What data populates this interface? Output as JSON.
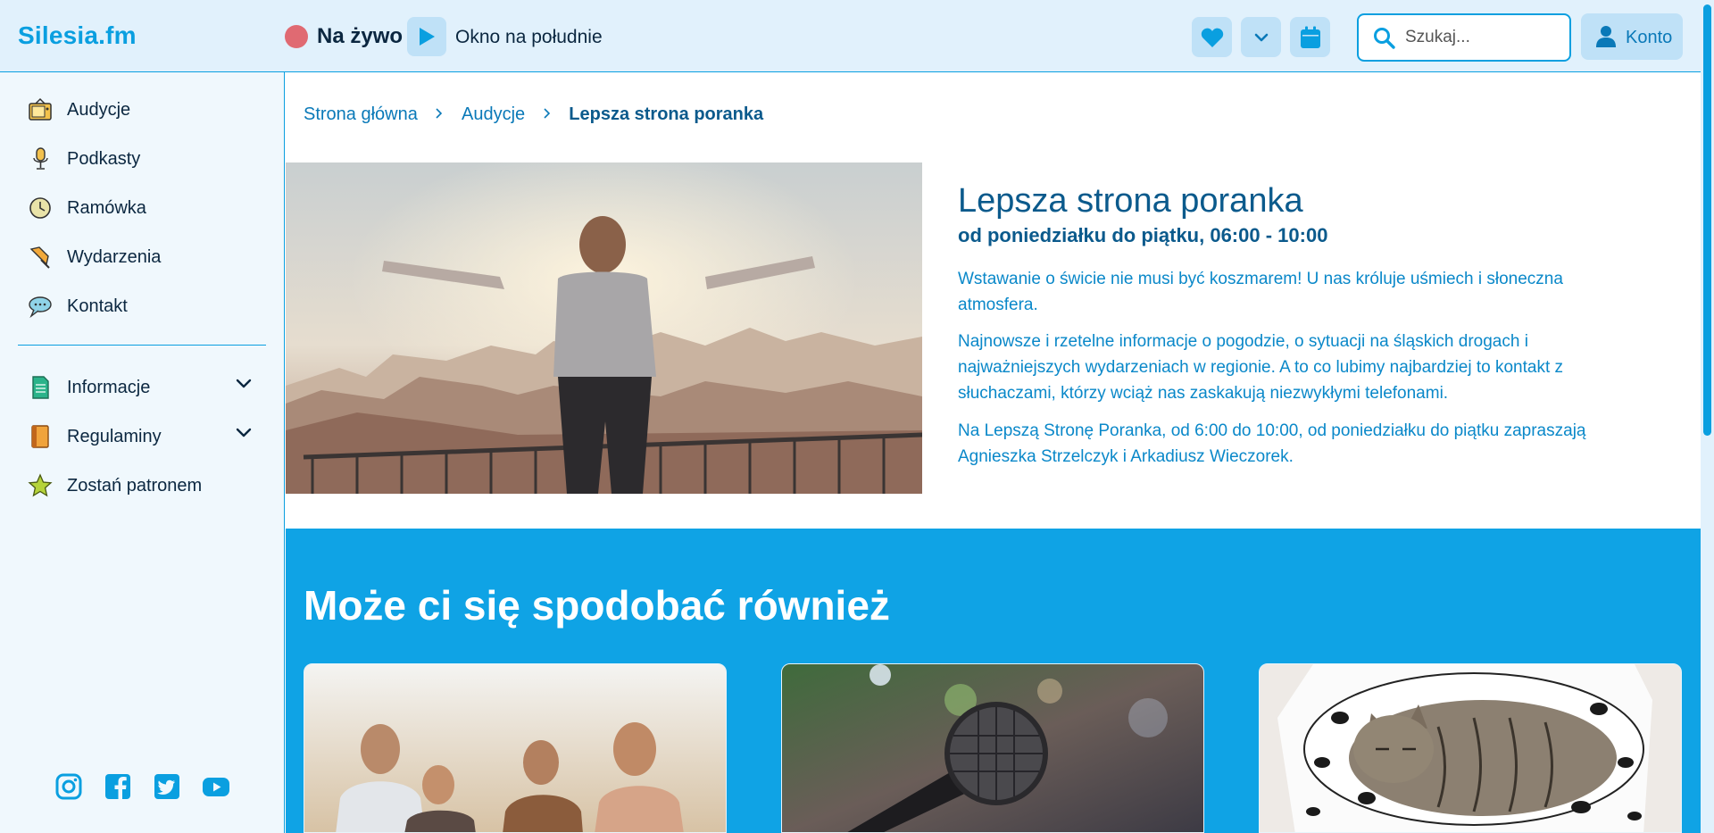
{
  "header": {
    "brand": "Silesia.fm",
    "live_label": "Na żywo",
    "now_playing": "Okno na południe",
    "search_placeholder": "Szukaj...",
    "account_label": "Konto",
    "icons": [
      "heart-icon",
      "chevron-down-icon",
      "calendar-icon",
      "search-icon",
      "user-icon",
      "play-icon"
    ]
  },
  "sidebar": {
    "items": [
      {
        "label": "Audycje",
        "icon": "tv-icon"
      },
      {
        "label": "Podkasty",
        "icon": "microphone-icon"
      },
      {
        "label": "Ramówka",
        "icon": "clock-icon"
      },
      {
        "label": "Wydarzenia",
        "icon": "pin-icon"
      },
      {
        "label": "Kontakt",
        "icon": "speech-bubble-icon"
      }
    ],
    "sections": [
      {
        "label": "Informacje",
        "icon": "document-icon"
      },
      {
        "label": "Regulaminy",
        "icon": "book-icon"
      }
    ],
    "patron_label": "Zostań patronem",
    "social": [
      "instagram-icon",
      "facebook-icon",
      "twitter-icon",
      "youtube-icon"
    ]
  },
  "breadcrumb": {
    "home": "Strona główna",
    "section": "Audycje",
    "current": "Lepsza strona poranka"
  },
  "show": {
    "title": "Lepsza strona poranka",
    "schedule": "od poniedziałku do piątku, 06:00 - 10:00",
    "paragraphs": [
      "Wstawanie o świcie nie musi być koszmarem! U nas króluje uśmiech i słoneczna atmosfera.",
      "Najnowsze i rzetelne informacje o pogodzie, o sytuacji na śląskich drogach i najważniejszych wydarzeniach w regionie. A to co lubimy najbardziej to kontakt z słuchaczami, którzy wciąż nas zaskakują niezwykłymi telefonami.",
      "Na Lepszą Stronę Poranka, od 6:00 do 10:00, od poniedziałku do piątku zapraszają Agnieszka Strzelczyk i Arkadiusz Wieczorek."
    ]
  },
  "recommendations": {
    "title": "Może ci się spodobać również"
  },
  "colors": {
    "accent": "#0a9fe0",
    "header_bg": "#e1f1fc",
    "sidebar_bg": "#f0f8fd",
    "section_bg": "#0fa3e5",
    "live_dot": "#e06a72",
    "dark_text": "#0b2740",
    "heading": "#0b5a8c"
  }
}
